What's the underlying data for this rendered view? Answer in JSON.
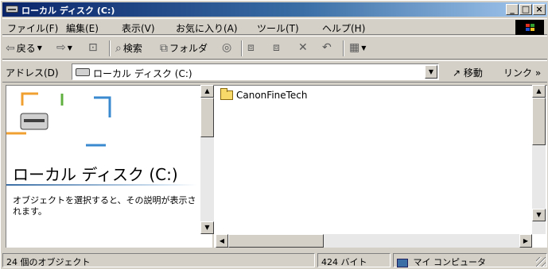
{
  "window": {
    "title": "ローカル ディスク (C:)"
  },
  "menu": {
    "items": [
      "ファイル(F)",
      "編集(E)",
      "表示(V)",
      "お気に入り(A)",
      "ツール(T)",
      "ヘルプ(H)"
    ]
  },
  "toolbar": {
    "back_label": "戻る",
    "search_label": "検索",
    "folders_label": "フォルダ"
  },
  "address": {
    "label": "アドレス(D)",
    "value": "ローカル ディスク (C:)",
    "go_label": "移動",
    "links_label": "リンク »"
  },
  "left_pane": {
    "title": "ローカル ディスク (C:)",
    "description": "オブジェクトを選択すると、その説明が表示されます。"
  },
  "files": [
    {
      "name": "CanonFineTech",
      "type": "folder-icon"
    }
  ],
  "status": {
    "object_count": "24 個のオブジェクト",
    "size": "424 バイト",
    "location": "マイ コンピュータ"
  },
  "colors": {
    "title_start": "#0a246a",
    "title_end": "#a6caf0",
    "chrome": "#d4d0c8"
  }
}
